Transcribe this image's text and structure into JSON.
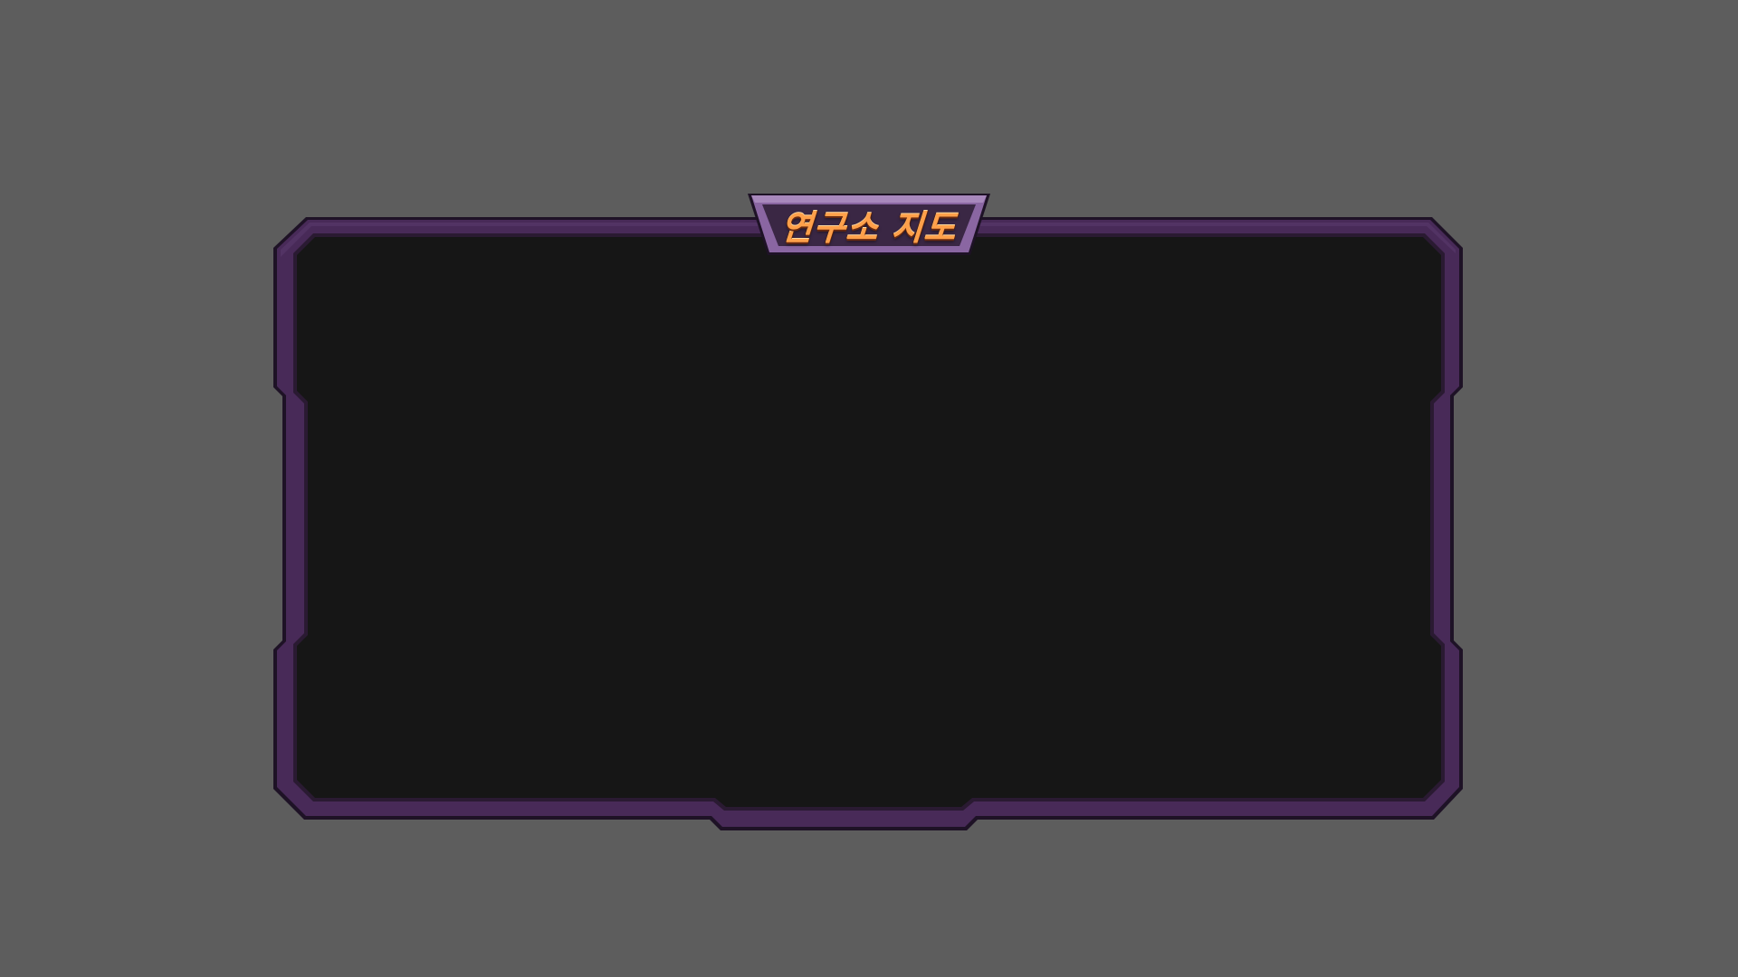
{
  "panel": {
    "title": "연구소 지도"
  },
  "colors": {
    "background": "#5d5d5d",
    "frame_purple": "#482a58",
    "frame_dark": "#1e1226",
    "panel_fill": "#161616",
    "title_tab_fill": "#3a2744",
    "title_tab_border": "#8a66a2",
    "title_text": "#ffa04a"
  }
}
